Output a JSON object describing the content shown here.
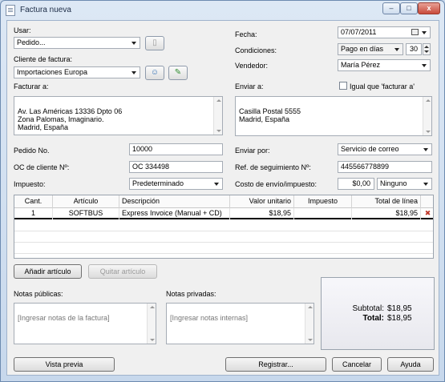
{
  "window": {
    "title": "Factura nueva",
    "min": "–",
    "max": "□",
    "close": "x"
  },
  "left": {
    "usar_label": "Usar:",
    "usar_value": "Pedido...",
    "cliente_label": "Cliente de factura:",
    "cliente_value": "Importaciones Europa",
    "facturar_label": "Facturar a:",
    "facturar_text": "Av. Las Américas 13336 Dpto 06\nZona Palomas, Imaginario.\nMadrid, España"
  },
  "right": {
    "fecha_label": "Fecha:",
    "fecha_value": "07/07/2011",
    "condiciones_label": "Condiciones:",
    "condiciones_value": "Pago en días",
    "condiciones_days": "30",
    "vendedor_label": "Vendedor:",
    "vendedor_value": "María Pérez",
    "enviar_label": "Enviar a:",
    "igual_label": "Igual que 'facturar a'",
    "enviar_text": "Casilla Postal 5555\nMadrid, España"
  },
  "mid": {
    "pedido_label": "Pedido No.",
    "pedido_value": "10000",
    "oc_label": "OC de cliente Nº:",
    "oc_value": "OC 334498",
    "impuesto_label": "Impuesto:",
    "impuesto_value": "Predeterminado",
    "enviar_por_label": "Enviar por:",
    "enviar_por_value": "Servicio de correo",
    "seguimiento_label": "Ref. de seguimiento Nº:",
    "seguimiento_value": "445566778899",
    "costo_label": "Costo de envío/impuesto:",
    "costo_value": "$0,00",
    "costo_tax_value": "Ninguno"
  },
  "table": {
    "headers": [
      "Cant.",
      "Artículo",
      "Descripción",
      "Valor unitario",
      "Impuesto",
      "Total de línea"
    ],
    "rows": [
      {
        "cant": "1",
        "articulo": "SOFTBUS",
        "descripcion": "Express Invoice (Manual + CD)",
        "valor": "$18,95",
        "impuesto": "",
        "total": "$18,95"
      }
    ]
  },
  "buttons": {
    "add_item": "Añadir artículo",
    "remove_item": "Quitar artículo",
    "preview": "Vista previa",
    "register": "Registrar...",
    "cancel": "Cancelar",
    "help": "Ayuda"
  },
  "notes": {
    "public_label": "Notas públicas:",
    "public_placeholder": "[Ingresar notas de la factura]",
    "private_label": "Notas privadas:",
    "private_placeholder": "[Ingresar notas internas]"
  },
  "totals": {
    "subtotal_label": "Subtotal:",
    "subtotal_value": "$18,95",
    "total_label": "Total:",
    "total_value": "$18,95"
  },
  "icons": {
    "doc": "document-icon",
    "contacts": "contacts-icon",
    "edit": "edit-icon",
    "calendar": "calendar-icon",
    "delete": "delete-row-icon"
  }
}
